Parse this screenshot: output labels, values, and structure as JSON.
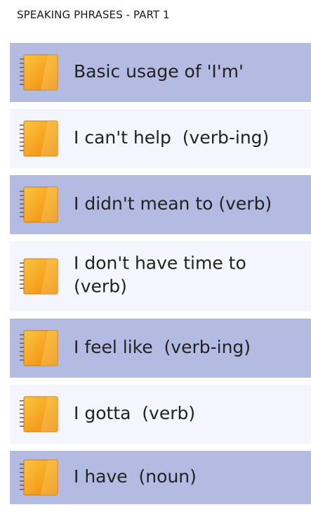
{
  "header": {
    "title": "SPEAKING PHRASES - PART 1"
  },
  "phrases": [
    {
      "label": "Basic usage of 'I'm'",
      "icon": "notebook-icon"
    },
    {
      "label": "I can't help  (verb-ing)",
      "icon": "notebook-icon"
    },
    {
      "label": "I didn't mean to (verb)",
      "icon": "notebook-icon"
    },
    {
      "label": "I don't have time to\n(verb)",
      "icon": "notebook-icon"
    },
    {
      "label": "I feel like  (verb-ing)",
      "icon": "notebook-icon"
    },
    {
      "label": "I gotta  (verb)",
      "icon": "notebook-icon"
    },
    {
      "label": "I have  (noun)",
      "icon": "notebook-icon"
    }
  ],
  "colors": {
    "row_alt": "#b4bbe2",
    "row_light": "#f5f6fd",
    "notebook_orange": "#f4a21e",
    "spiral": "#8a6a3a"
  }
}
